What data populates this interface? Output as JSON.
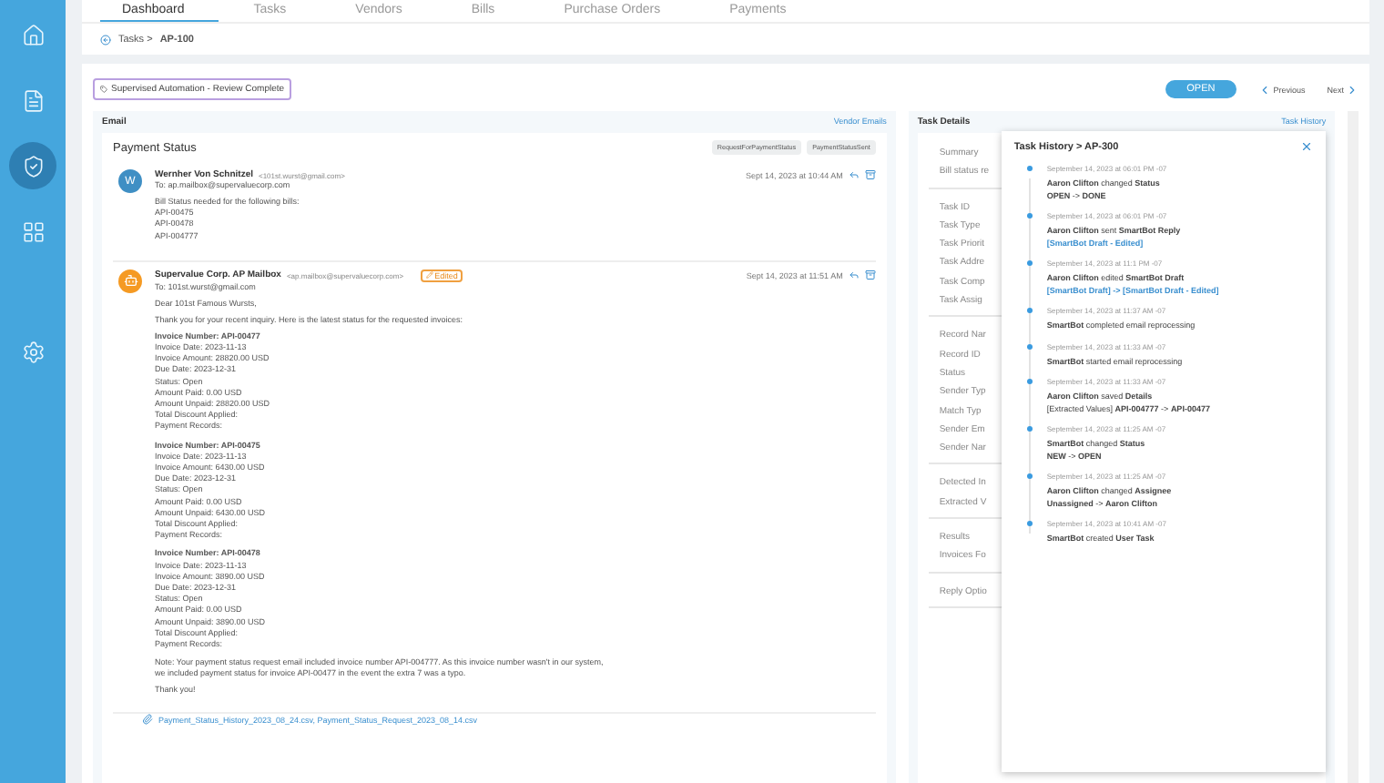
{
  "sidebar": {
    "items": [
      {
        "selected": false
      },
      {
        "selected": false
      },
      {
        "selected": true
      },
      {
        "selected": false
      },
      {
        "selected": false
      }
    ]
  },
  "nav": {
    "tabs": [
      {
        "label": "Dashboard",
        "selected": true
      },
      {
        "label": "Tasks",
        "selected": false
      },
      {
        "label": "Vendors",
        "selected": false
      },
      {
        "label": "Bills",
        "selected": false
      },
      {
        "label": "Purchase Orders",
        "selected": false
      },
      {
        "label": "Payments",
        "selected": false
      }
    ]
  },
  "breadcrumb": {
    "parent": "Tasks >",
    "current": "AP-100"
  },
  "toolbar": {
    "badge": "Supervised Automation - Review Complete",
    "status": "OPEN",
    "previous": "Previous",
    "next": "Next"
  },
  "email": {
    "title": "Email",
    "link": "Vendor Emails",
    "subject": "Payment Status",
    "tags": [
      "RequestForPaymentStatus",
      "PaymentStatusSent"
    ],
    "messages": [
      {
        "kind": "person",
        "initial": "W",
        "from": "Wernher Von Schnitzel",
        "address": "<101st.wurst@gmail.com>",
        "to": "To: ap.mailbox@supervaluecorp.com",
        "date": "Sept 14, 2023 at 10:44 AM",
        "blocks": [
          {
            "kind": "lines",
            "lines": [
              "Bill Status needed for the following bills:",
              "API-00475",
              "API-00478",
              "API-004777"
            ]
          }
        ]
      },
      {
        "kind": "bot",
        "from": "Supervalue Corp. AP Mailbox",
        "address": "<ap.mailbox@supervaluecorp.com>",
        "to": "To: 101st.wurst@gmail.com",
        "date": "Sept 14, 2023 at 11:51 AM",
        "edited": true,
        "edited_label": "Edited",
        "blocks": [
          {
            "kind": "para",
            "lines": [
              "Dear 101st Famous Wursts,"
            ]
          },
          {
            "kind": "para",
            "lines": [
              "Thank you for your recent inquiry. Here is the latest status for the requested invoices:"
            ]
          },
          {
            "kind": "invoice",
            "title": "Invoice Number: API-00477",
            "lines": [
              "Invoice Date: 2023-11-13",
              "Invoice Amount: 28820.00 USD",
              "Due Date: 2023-12-31",
              "Status: Open",
              "Amount Paid: 0.00 USD",
              "Amount Unpaid: 28820.00 USD",
              "Total Discount Applied:",
              "Payment Records:"
            ]
          },
          {
            "kind": "invoice",
            "title": "Invoice Number: API-00475",
            "lines": [
              "Invoice Date: 2023-11-13",
              "Invoice Amount: 6430.00 USD",
              "Due Date: 2023-12-31",
              "Status: Open",
              "Amount Paid: 0.00 USD",
              "Amount Unpaid: 6430.00 USD",
              "Total Discount Applied:",
              "Payment Records:"
            ]
          },
          {
            "kind": "invoice",
            "title": "Invoice Number: API-00478",
            "lines": [
              "Invoice Date: 2023-11-13",
              "Invoice Amount: 3890.00 USD",
              "Due Date: 2023-12-31",
              "Status: Open",
              "Amount Paid: 0.00 USD",
              "Amount Unpaid: 3890.00 USD",
              "Total Discount Applied:",
              "Payment Records:"
            ]
          },
          {
            "kind": "para",
            "lines": [
              "Note: Your payment status request email included invoice number API-004777. As this invoice number wasn't in our system, we included payment status for invoice API-00477 in the event the extra 7 was a typo."
            ]
          },
          {
            "kind": "para",
            "lines": [
              "Thank you!"
            ]
          }
        ]
      }
    ],
    "attachments": "Payment_Status_History_2023_08_24.csv, Payment_Status_Request_2023_08_14.csv"
  },
  "task_details": {
    "title": "Task Details",
    "link": "Task History",
    "groups": [
      [
        "Summary",
        "Bill status re"
      ],
      [
        "Task ID",
        "Task Type",
        "Task Priorit",
        "Task Addre",
        "Task Comp",
        "Task Assig"
      ],
      [
        "Record Nar",
        "Record ID",
        "Status",
        "Sender Typ",
        "Match Typ",
        "Sender Em",
        "Sender Nar"
      ],
      [
        "Detected In",
        "Extracted V"
      ],
      [
        "Results",
        "Invoices Fo"
      ],
      [
        "Reply Optio"
      ]
    ]
  },
  "task_history": {
    "title": "Task History > AP-300",
    "entries": [
      {
        "time": "September 14, 2023 at 06:01 PM -07",
        "text": "**Aaron Clifton** changed **Status**",
        "change": "**OPEN** -> **DONE**",
        "kind": "plain"
      },
      {
        "time": "September 14, 2023 at 06:01 PM -07",
        "text": "**Aaron Clifton** sent **SmartBot Reply**",
        "change": "[SmartBot Draft - Edited]",
        "kind": "link"
      },
      {
        "time": "September 14, 2023 at 11:1 PM -07",
        "text": "**Aaron Clifton** edited **SmartBot Draft**",
        "change": "[SmartBot Draft] -> [SmartBot Draft - Edited]",
        "kind": "link"
      },
      {
        "time": "September 14, 2023 at 11:37 AM -07",
        "text": "**SmartBot** completed email reprocessing"
      },
      {
        "time": "September 14, 2023 at 11:33 AM -07",
        "text": "**SmartBot** started email reprocessing"
      },
      {
        "time": "September 14, 2023 at 11:33 AM -07",
        "text": "**Aaron Clifton** saved **Details**",
        "change": "[Extracted Values] **API-004777** -> **API-00477**",
        "kind": "plain"
      },
      {
        "time": "September 14, 2023 at 11:25 AM -07",
        "text": "**SmartBot** changed **Status**",
        "change": "**NEW** -> **OPEN**",
        "kind": "plain"
      },
      {
        "time": "September 14, 2023 at 11:25 AM -07",
        "text": "**Aaron Clifton** changed **Assignee**",
        "change": "**Unassigned** -> **Aaron Clifton**",
        "kind": "plain"
      },
      {
        "time": "September 14, 2023 at 10:41 AM -07",
        "text": "**SmartBot** created **User Task**"
      }
    ]
  }
}
